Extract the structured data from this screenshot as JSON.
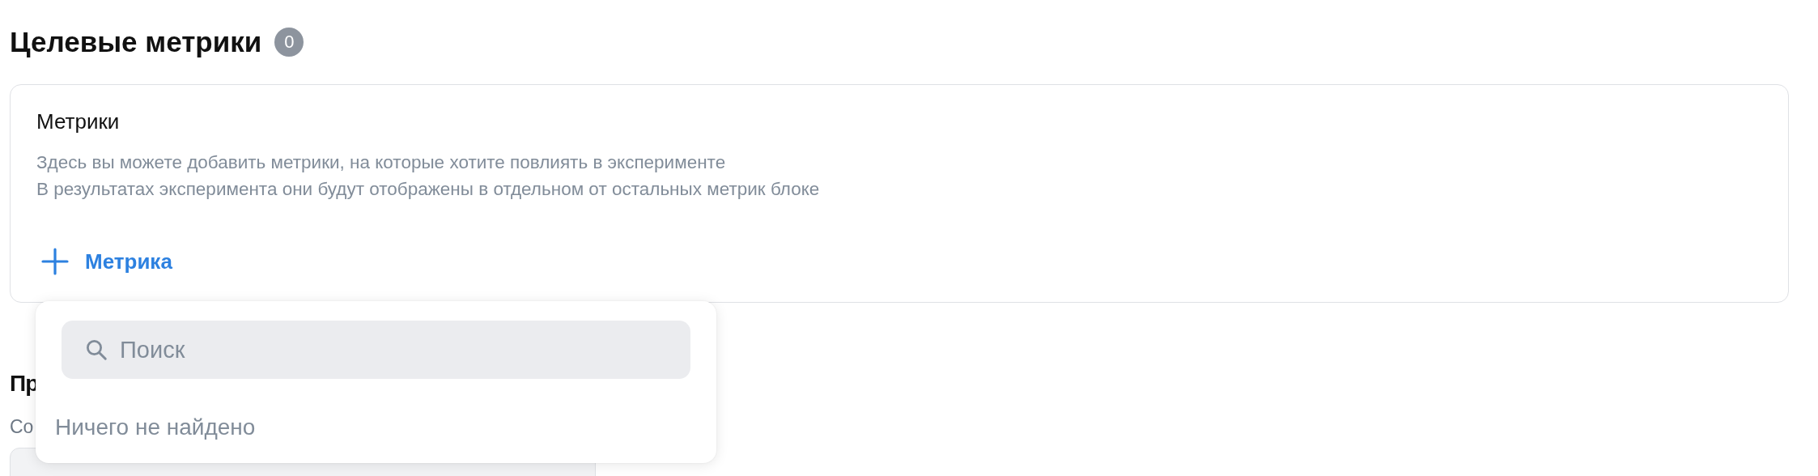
{
  "section": {
    "title": "Целевые метрики",
    "count": "0"
  },
  "card": {
    "title": "Метрики",
    "description": [
      "Здесь вы можете добавить метрики, на которые хотите повлиять в эксперименте",
      "В результатах эксперимента они будут отображены в отдельном от остальных метрик блоке"
    ],
    "add_button": "Метрика"
  },
  "dropdown": {
    "search": {
      "placeholder": "Поиск"
    },
    "empty_text": "Ничего не найдено"
  },
  "next_section": {
    "title": "Пр",
    "caption": "Со",
    "field": {
      "kind": "input"
    }
  }
}
